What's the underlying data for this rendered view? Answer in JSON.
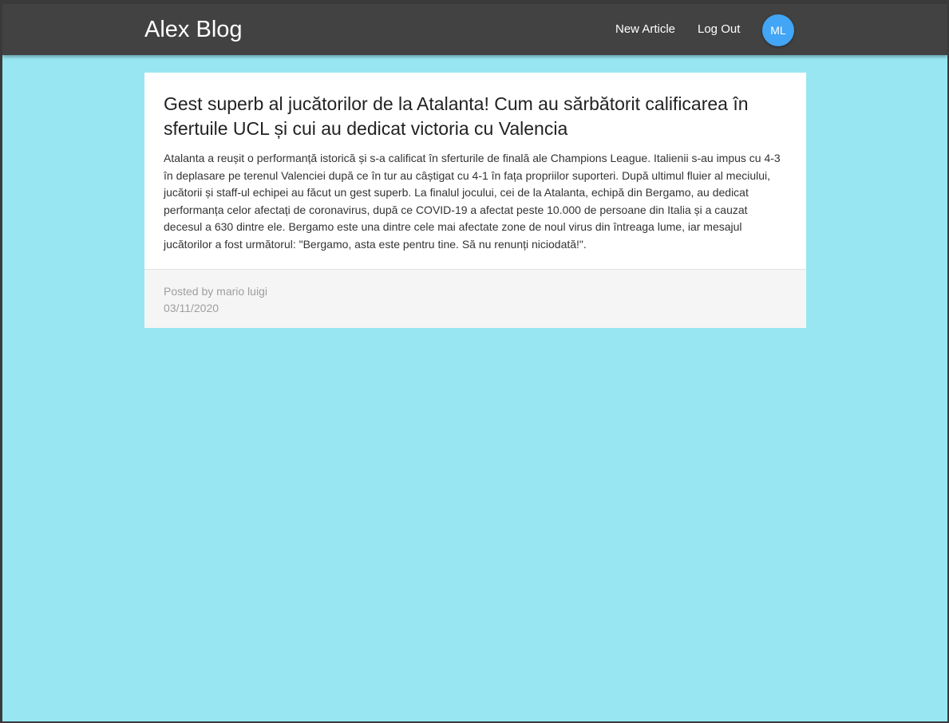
{
  "header": {
    "brand": "Alex Blog",
    "nav": {
      "new_article": "New Article",
      "log_out": "Log Out"
    },
    "avatar_initials": "ML"
  },
  "article": {
    "title": "Gest superb al jucătorilor de la Atalanta! Cum au sărbătorit calificarea în sfertuile UCL și cui au dedicat victoria cu Valencia",
    "body": "Atalanta a reușit o performanță istorică și s-a calificat în sferturile de finală ale Champions League. Italienii s-au impus cu 4-3 în deplasare pe terenul Valenciei după ce în tur au câștigat cu 4-1 în fața propriilor suporteri. După ultimul fluier al meciului, jucătorii și staff-ul echipei au făcut un gest superb. La finalul jocului, cei de la Atalanta, echipă din Bergamo, au dedicat performanța celor afectați de coronavirus, după ce COVID-19 a afectat peste 10.000 de persoane din Italia și a cauzat decesul a 630 dintre ele. Bergamo este una dintre cele mai afectate zone de noul virus din întreaga lume, iar mesajul jucătorilor a fost următorul: \"Bergamo, asta este pentru tine. Să nu renunți niciodată!\".",
    "posted_by": "Posted by mario luigi",
    "date": "03/11/2020"
  },
  "colors": {
    "page_background": "#98e6f2",
    "header_background": "#424242",
    "avatar_background": "#42a5f5",
    "card_background": "#ffffff",
    "footer_background": "#f5f5f5",
    "meta_text": "#9e9e9e"
  }
}
